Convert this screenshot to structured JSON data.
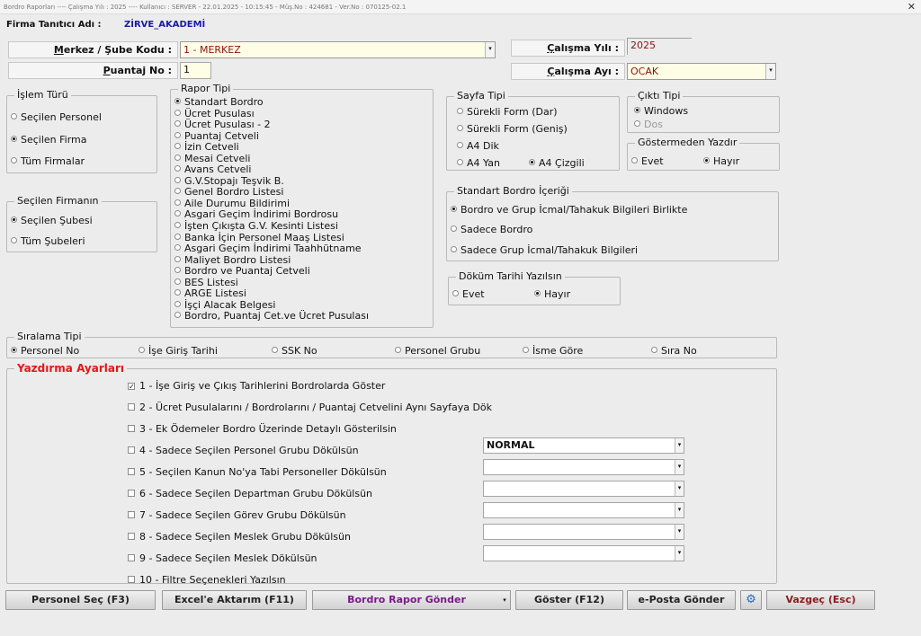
{
  "window": {
    "title": "Bordro Raporları  ----  Çalışma Yılı : 2025  ----  Kullanıcı : SERVER - 22.01.2025 - 10:15:45 - Müş.No : 424681 - Ver.No : 070125-02.1",
    "close": "✕"
  },
  "firma": {
    "label": "Firma Tanıtıcı Adı :",
    "value": "ZİRVE_AKADEMİ"
  },
  "merkez": {
    "label_underline": "M",
    "label_rest": "erkez / Şube Kodu :",
    "value": "1 - MERKEZ"
  },
  "puantaj": {
    "label_underline": "P",
    "label_rest": "uantaj No :",
    "value": "1"
  },
  "calisma_yili": {
    "label_underline": "Ç",
    "label_rest": "alışma Yılı :",
    "value": "2025"
  },
  "calisma_ayi": {
    "label_underline": "Ç",
    "label_rest": "alışma Ayı :",
    "value": "OCAK"
  },
  "islem_turu": {
    "legend": "İşlem Türü",
    "options": [
      "Seçilen Personel",
      "Seçilen Firma",
      "Tüm Firmalar"
    ],
    "selected": "Seçilen Firma"
  },
  "secilen_firmanin": {
    "legend": "Seçilen Firmanın",
    "options": [
      "Seçilen Şubesi",
      "Tüm Şubeleri"
    ],
    "selected": "Seçilen Şubesi"
  },
  "rapor_tipi": {
    "legend": "Rapor Tipi",
    "items": [
      "Standart Bordro",
      "Ücret Pusulası",
      "Ücret Pusulası - 2",
      "Puantaj Cetveli",
      "İzin Cetveli",
      "Mesai Cetveli",
      "Avans Cetveli",
      "G.V.Stopajı Teşvik B.",
      "Genel Bordro Listesi",
      "Aile Durumu Bildirimi",
      "Asgari Geçim İndirimi Bordrosu",
      "İşten Çıkışta G.V. Kesinti Listesi",
      "Banka İçin Personel Maaş Listesi",
      "Asgari Geçim İndirimi Taahhütname",
      "Maliyet Bordro Listesi",
      "Bordro ve Puantaj Cetveli",
      "BES Listesi",
      "ARGE Listesi",
      "İşçi Alacak Belgesi",
      "Bordro, Puantaj Cet.ve Ücret Pusulası"
    ],
    "selected": "Standart Bordro"
  },
  "sayfa_tipi": {
    "legend": "Sayfa Tipi",
    "options": [
      "Sürekli Form (Dar)",
      "Sürekli Form (Geniş)",
      "A4 Dik",
      "A4 Yan",
      "A4 Çizgili"
    ],
    "selected": "A4 Çizgili"
  },
  "cikti_tipi": {
    "legend": "Çıktı Tipi",
    "options": [
      "Windows",
      "Dos"
    ],
    "selected": "Windows"
  },
  "gostermeden": {
    "legend": "Göstermeden Yazdır",
    "options": [
      "Evet",
      "Hayır"
    ],
    "selected": "Hayır"
  },
  "standart_icerik": {
    "legend": "Standart Bordro İçeriği",
    "options": [
      "Bordro ve Grup İcmal/Tahakuk Bilgileri Birlikte",
      "Sadece Bordro",
      "Sadece Grup İcmal/Tahakuk Bilgileri"
    ],
    "selected": "Bordro ve Grup İcmal/Tahakuk Bilgileri Birlikte"
  },
  "dokum_tarihi": {
    "legend": "Döküm Tarihi Yazılsın",
    "options": [
      "Evet",
      "Hayır"
    ],
    "selected": "Hayır"
  },
  "siralama": {
    "legend": "Sıralama Tipi",
    "options": [
      "Personel No",
      "İşe Giriş Tarihi",
      "SSK No",
      "Personel Grubu",
      "İsme Göre",
      "Sıra No"
    ],
    "selected": "Personel No"
  },
  "yazdirma": {
    "legend": "Yazdırma Ayarları",
    "items": [
      {
        "label": "1 -  İşe Giriş ve Çıkış Tarihlerini Bordrolarda Göster",
        "checked": true
      },
      {
        "label": "2 - Ücret Pusulalarını / Bordrolarını / Puantaj Cetvelini Aynı Sayfaya Dök",
        "checked": false
      },
      {
        "label": "3 - Ek Ödemeler Bordro Üzerinde Detaylı Gösterilsin",
        "checked": false
      },
      {
        "label": "4 - Sadece Seçilen Personel Grubu Dökülsün",
        "checked": false
      },
      {
        "label": "5 - Seçilen Kanun No'ya Tabi Personeller Dökülsün",
        "checked": false
      },
      {
        "label": "6 - Sadece Seçilen Departman Grubu Dökülsün",
        "checked": false
      },
      {
        "label": "7 - Sadece Seçilen Görev Grubu Dökülsün",
        "checked": false
      },
      {
        "label": "8 - Sadece Seçilen Meslek Grubu Dökülsün",
        "checked": false
      },
      {
        "label": "9 - Sadece Seçilen Meslek Dökülsün",
        "checked": false
      },
      {
        "label": "10 - Filtre Seçenekleri Yazılsın",
        "checked": false
      }
    ],
    "dropdowns": [
      "NORMAL",
      "",
      "",
      "",
      "",
      ""
    ],
    "check_mark": "✓"
  },
  "buttons": {
    "personel_sec": "Personel Seç (F3)",
    "excel": "Excel'e Aktarım (F11)",
    "gonder": "Bordro Rapor Gönder",
    "goster": "Göster (F12)",
    "eposta": "e-Posta Gönder",
    "vazgec": "Vazgeç (Esc)"
  },
  "icons": {
    "dropdown_arrow": "▾",
    "settings": "⚙"
  },
  "colors": {
    "accent_blue": "#1a1aa6",
    "value_red": "#8a1313",
    "purple": "#7a1a8c",
    "red_text": "#e31717",
    "vazgec": "#8a1d1d"
  }
}
